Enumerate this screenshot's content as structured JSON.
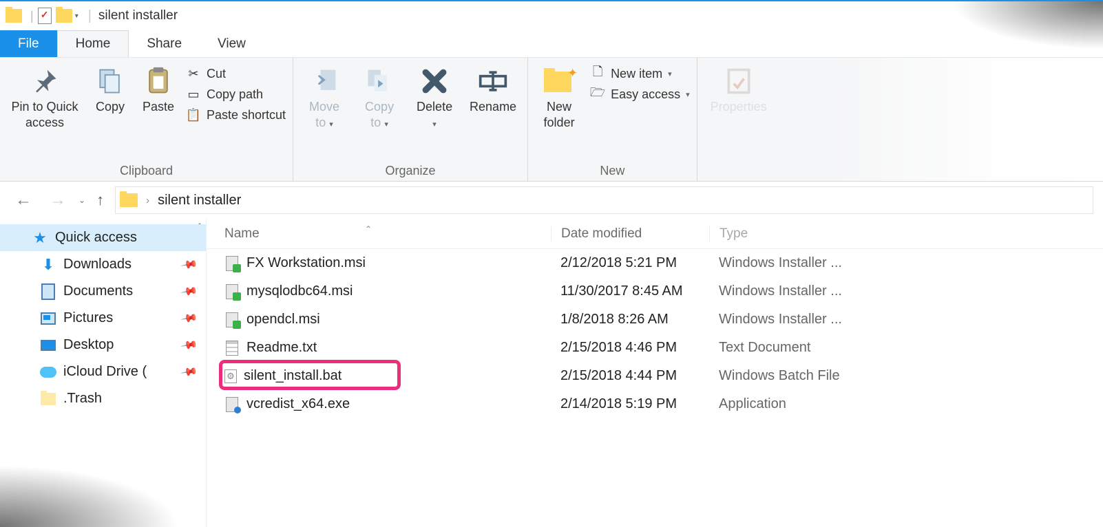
{
  "window": {
    "title": "silent installer"
  },
  "tabs": {
    "file": "File",
    "home": "Home",
    "share": "Share",
    "view": "View"
  },
  "ribbon": {
    "clipboard": {
      "label": "Clipboard",
      "pin": "Pin to Quick\naccess",
      "copy": "Copy",
      "paste": "Paste",
      "cut": "Cut",
      "copy_path": "Copy path",
      "paste_shortcut": "Paste shortcut"
    },
    "organize": {
      "label": "Organize",
      "move_to": "Move\nto",
      "copy_to": "Copy\nto",
      "delete": "Delete",
      "rename": "Rename"
    },
    "new": {
      "label": "New",
      "new_folder": "New\nfolder",
      "new_item": "New item",
      "easy_access": "Easy access"
    },
    "open": {
      "properties": "Properties"
    }
  },
  "breadcrumb": {
    "folder": "silent installer"
  },
  "sidebar": {
    "quick_access": "Quick access",
    "downloads": "Downloads",
    "documents": "Documents",
    "pictures": "Pictures",
    "desktop": "Desktop",
    "icloud": "iCloud Drive (",
    "trash": ".Trash"
  },
  "columns": {
    "name": "Name",
    "date": "Date modified",
    "type": "Type"
  },
  "files": [
    {
      "name": "FX Workstation.msi",
      "date": "2/12/2018 5:21 PM",
      "type": "Windows Installer ...",
      "icon": "msi"
    },
    {
      "name": "mysqlodbc64.msi",
      "date": "11/30/2017 8:45 AM",
      "type": "Windows Installer ...",
      "icon": "msi"
    },
    {
      "name": "opendcl.msi",
      "date": "1/8/2018 8:26 AM",
      "type": "Windows Installer ...",
      "icon": "msi"
    },
    {
      "name": "Readme.txt",
      "date": "2/15/2018 4:46 PM",
      "type": "Text Document",
      "icon": "txt"
    },
    {
      "name": "silent_install.bat",
      "date": "2/15/2018 4:44 PM",
      "type": "Windows Batch File",
      "icon": "bat",
      "highlight": true
    },
    {
      "name": "vcredist_x64.exe",
      "date": "2/14/2018 5:19 PM",
      "type": "Application",
      "icon": "exe"
    }
  ]
}
